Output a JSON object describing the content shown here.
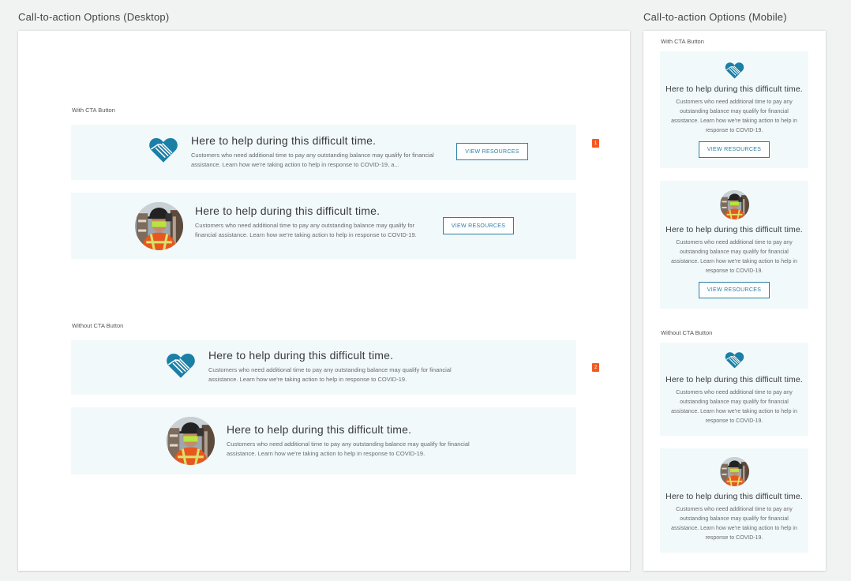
{
  "desktop": {
    "frame_title": "Call-to-action Options (Desktop)",
    "with_cta_label": "With CTA Button",
    "without_cta_label": "Without CTA Button",
    "marker_1": "1",
    "marker_2": "2",
    "banners": [
      {
        "title": "Here to help during this difficult time.",
        "body": "Customers who need additional time to pay any outstanding balance may qualify for financial assistance. Learn how we're taking action to help in response to COVID-19, a...",
        "cta": "VIEW RESOURCES"
      },
      {
        "title": "Here to help during this difficult time.",
        "body": "Customers who need additional time to pay any outstanding balance may qualify for financial assistance. Learn how we're taking action to help in response to COVID-19.",
        "cta": "VIEW RESOURCES"
      },
      {
        "title": "Here to help during this difficult time.",
        "body": "Customers who need additional time to pay any outstanding balance may qualify for financial assistance. Learn how we're taking action to help in response to COVID-19."
      },
      {
        "title": "Here to help during this difficult time.",
        "body": "Customers who need additional time to pay any outstanding balance may qualify for financial assistance. Learn how we're taking action to help in response to COVID-19."
      }
    ]
  },
  "mobile": {
    "frame_title": "Call-to-action Options (Mobile)",
    "with_cta_label": "With CTA Button",
    "without_cta_label": "Without CTA Button",
    "banners": [
      {
        "title": "Here to help during this difficult time.",
        "body": "Customers who need additional time to pay any outstanding balance may qualify for financial assistance. Learn how we're taking action to help in response to COVID-19.",
        "cta": "VIEW RESOURCES"
      },
      {
        "title": "Here to help during this difficult time.",
        "body": "Customers who need additional time to pay any outstanding balance may qualify for financial assistance. Learn how we're taking action to help in response to COVID-19.",
        "cta": "VIEW RESOURCES"
      },
      {
        "title": "Here to help during this difficult time.",
        "body": "Customers who need additional time to pay any outstanding balance may qualify for financial assistance. Learn how we're taking action to help in response to COVID-19."
      },
      {
        "title": "Here to help during this difficult time.",
        "body": "Customers who need additional time to pay any outstanding balance may qualify for financial assistance. Learn how we're taking action to help in response to COVID-19."
      }
    ]
  },
  "colors": {
    "brand_blue": "#1b7fa6",
    "banner_bg": "#f2f9fb",
    "marker_orange": "#f15a22"
  },
  "icons": {
    "heart": "heart-hands-icon",
    "avatar": "worker-photo-avatar"
  }
}
